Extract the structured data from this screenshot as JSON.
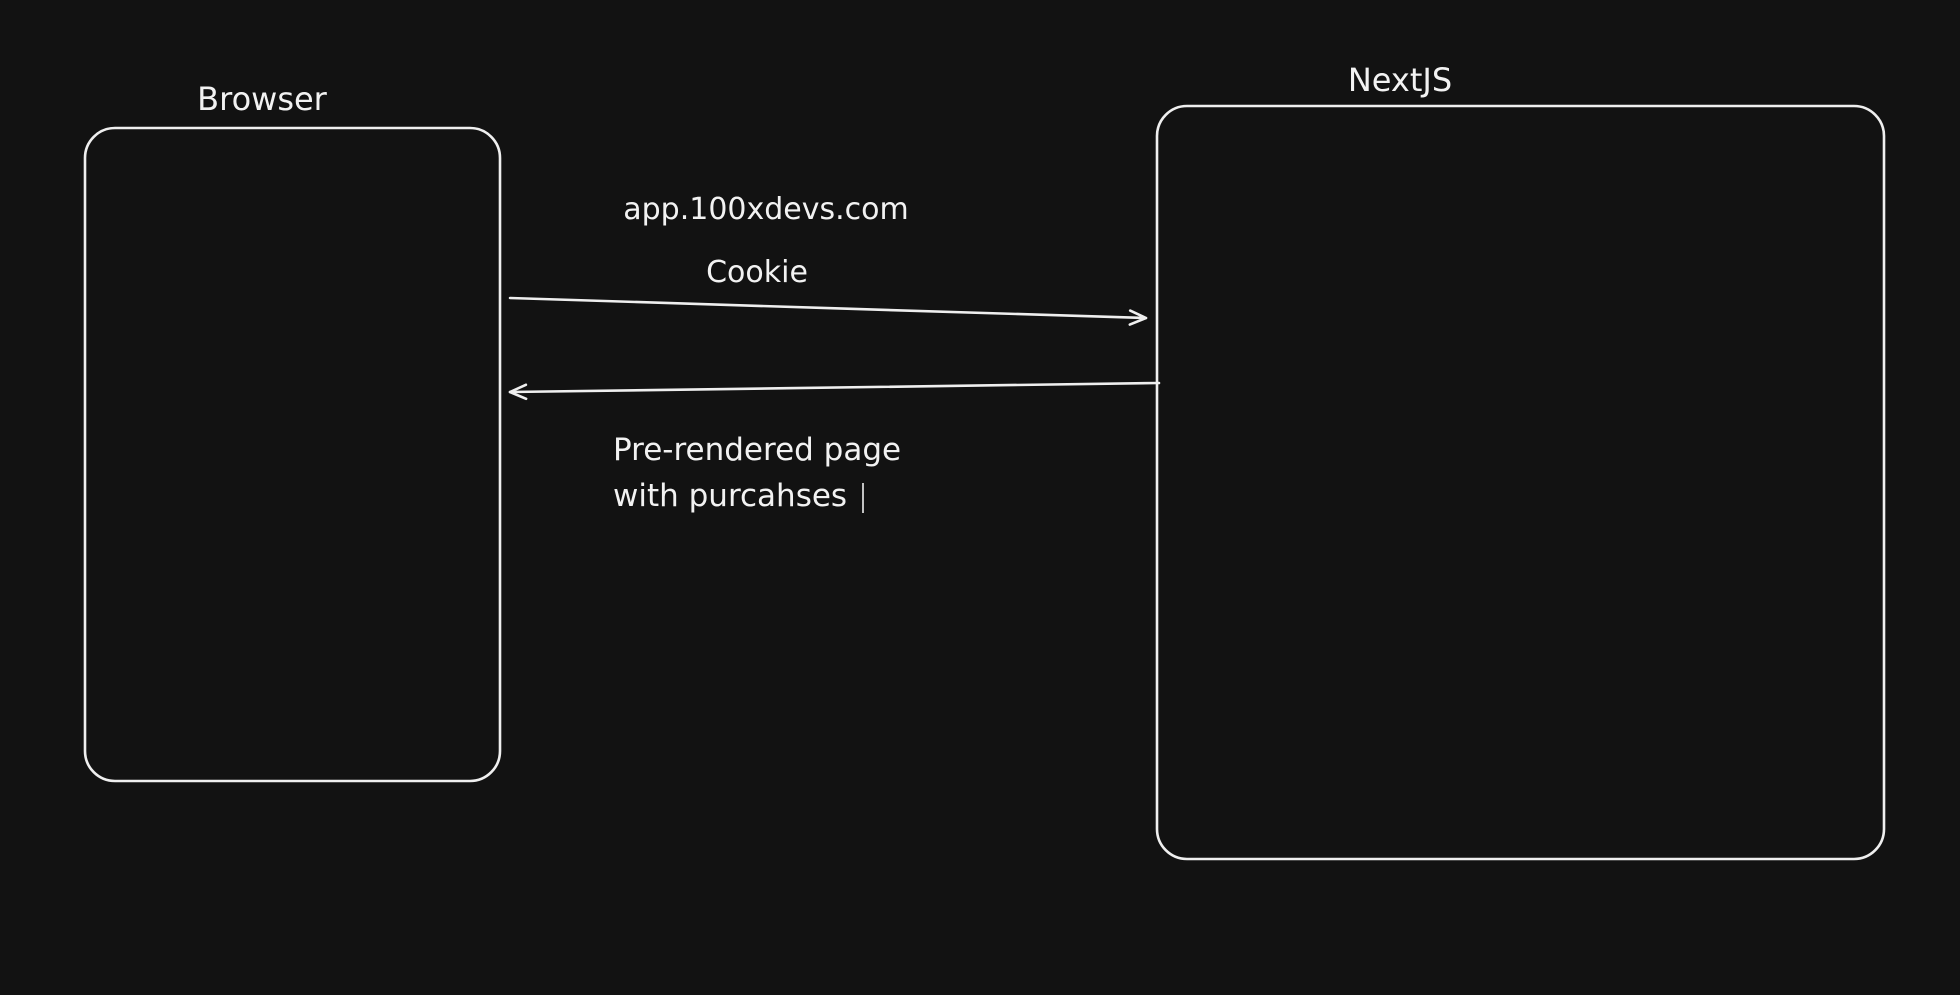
{
  "colors": {
    "background": "#121212",
    "stroke": "#efefef",
    "text": "#f2f2f2"
  },
  "browser": {
    "label": "Browser"
  },
  "server": {
    "label": "NextJS"
  },
  "request": {
    "url": "app.100xdevs.com",
    "payload": "Cookie"
  },
  "response": {
    "line1": "Pre-rendered page",
    "line2": "with purcahses"
  }
}
